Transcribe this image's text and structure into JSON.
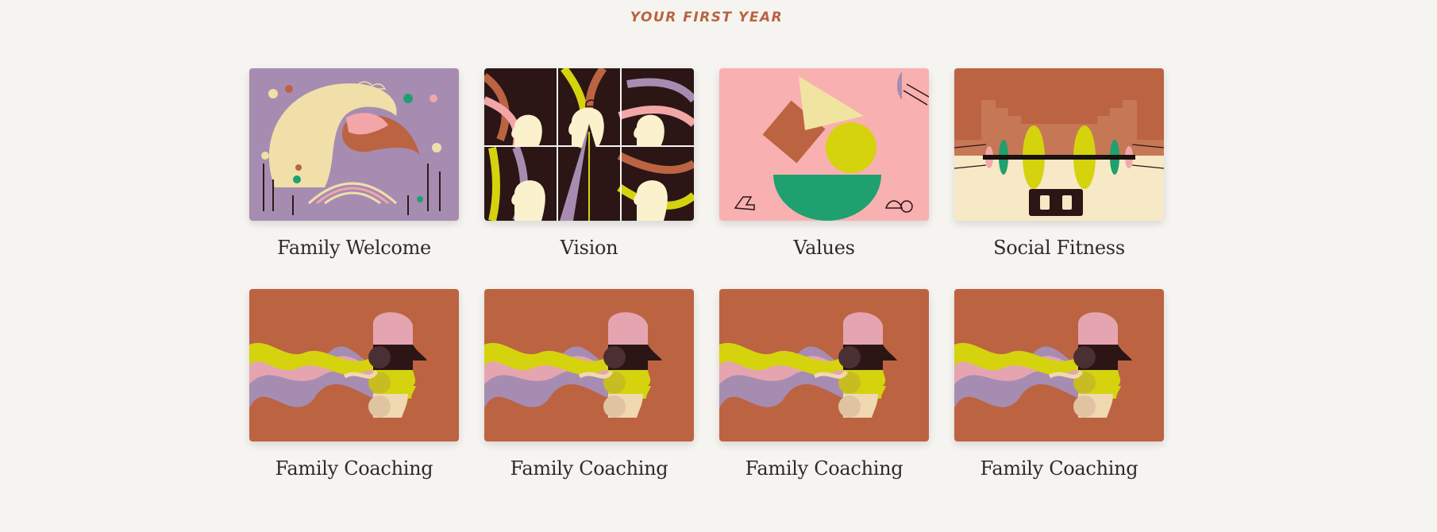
{
  "section": {
    "title": "YOUR FIRST YEAR"
  },
  "cards": [
    {
      "label": "Family Welcome",
      "art": "family-welcome"
    },
    {
      "label": "Vision",
      "art": "vision"
    },
    {
      "label": "Values",
      "art": "values"
    },
    {
      "label": "Social Fitness",
      "art": "social-fitness"
    },
    {
      "label": "Family Coaching",
      "art": "family-coaching"
    },
    {
      "label": "Family Coaching",
      "art": "family-coaching"
    },
    {
      "label": "Family Coaching",
      "art": "family-coaching"
    },
    {
      "label": "Family Coaching",
      "art": "family-coaching"
    }
  ],
  "colors": {
    "background": "#f6f4f0",
    "accent": "#b8643f",
    "text": "#2e2b29"
  }
}
